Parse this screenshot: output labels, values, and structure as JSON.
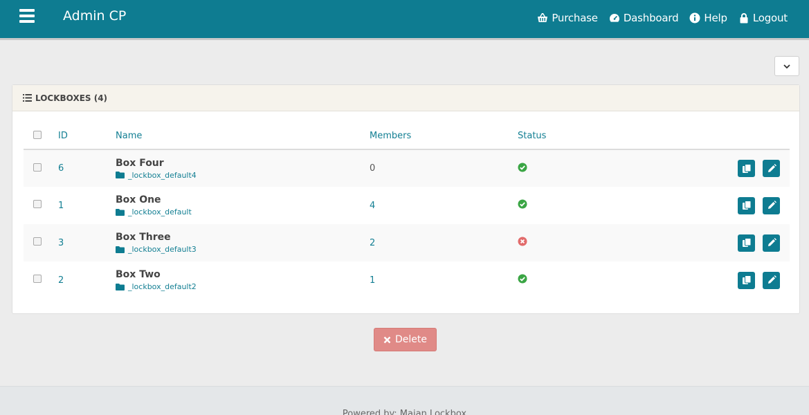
{
  "header": {
    "brand": "Admin CP",
    "nav": [
      {
        "label": "Purchase",
        "icon": "basket-icon"
      },
      {
        "label": "Dashboard",
        "icon": "dashboard-icon"
      },
      {
        "label": "Help",
        "icon": "info-icon"
      },
      {
        "label": "Logout",
        "icon": "lock-icon"
      }
    ]
  },
  "panel": {
    "title": "LOCKBOXES (4)",
    "columns": {
      "id": "ID",
      "name": "Name",
      "members": "Members",
      "status": "Status"
    },
    "rows": [
      {
        "id": "6",
        "name": "Box Four",
        "folder": "_lockbox_default4",
        "members": "0",
        "status": "active"
      },
      {
        "id": "1",
        "name": "Box One",
        "folder": "_lockbox_default",
        "members": "4",
        "status": "active"
      },
      {
        "id": "3",
        "name": "Box Three",
        "folder": "_lockbox_default3",
        "members": "2",
        "status": "inactive"
      },
      {
        "id": "2",
        "name": "Box Two",
        "folder": "_lockbox_default2",
        "members": "1",
        "status": "active"
      }
    ]
  },
  "actions": {
    "delete_label": "Delete"
  },
  "footer": {
    "text": "Powered by: Maian Lockbox"
  },
  "colors": {
    "brand": "#0e7c91",
    "active": "#3aa544",
    "inactive": "#e26b6b",
    "delete": "#e08a87"
  }
}
